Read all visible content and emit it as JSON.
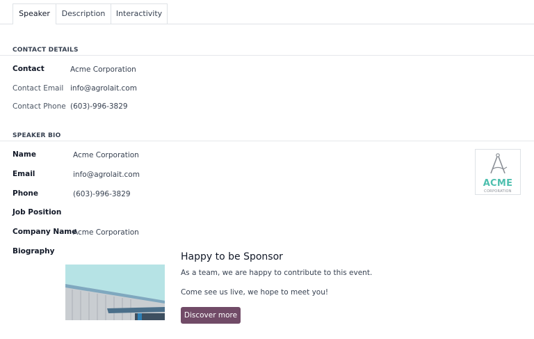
{
  "tabs": [
    {
      "label": "Speaker",
      "active": true
    },
    {
      "label": "Description",
      "active": false
    },
    {
      "label": "Interactivity",
      "active": false
    }
  ],
  "contact_details": {
    "title": "CONTACT DETAILS",
    "fields": [
      {
        "label": "Contact",
        "value": "Acme Corporation"
      },
      {
        "label": "Contact Email",
        "value": "info@agrolait.com"
      },
      {
        "label": "Contact Phone",
        "value": "(603)-996-3829"
      }
    ]
  },
  "speaker_bio": {
    "title": "SPEAKER BIO",
    "fields": [
      {
        "label": "Name",
        "value": "Acme Corporation"
      },
      {
        "label": "Email",
        "value": "info@agrolait.com"
      },
      {
        "label": "Phone",
        "value": "(603)-996-3829"
      },
      {
        "label": "Job Position",
        "value": ""
      },
      {
        "label": "Company Name",
        "value": "Acme Corporation"
      },
      {
        "label": "Biography",
        "value": ""
      }
    ],
    "logo": {
      "word": "ACME",
      "sub": "CORPORATION",
      "accent": "#4ebfae"
    }
  },
  "biography": {
    "heading": "Happy to be Sponsor",
    "line1": "As a team, we are happy to contribute to this event.",
    "line2": "Come see us live, we hope to meet you!",
    "button": "Discover more",
    "button_color": "#714b67"
  }
}
